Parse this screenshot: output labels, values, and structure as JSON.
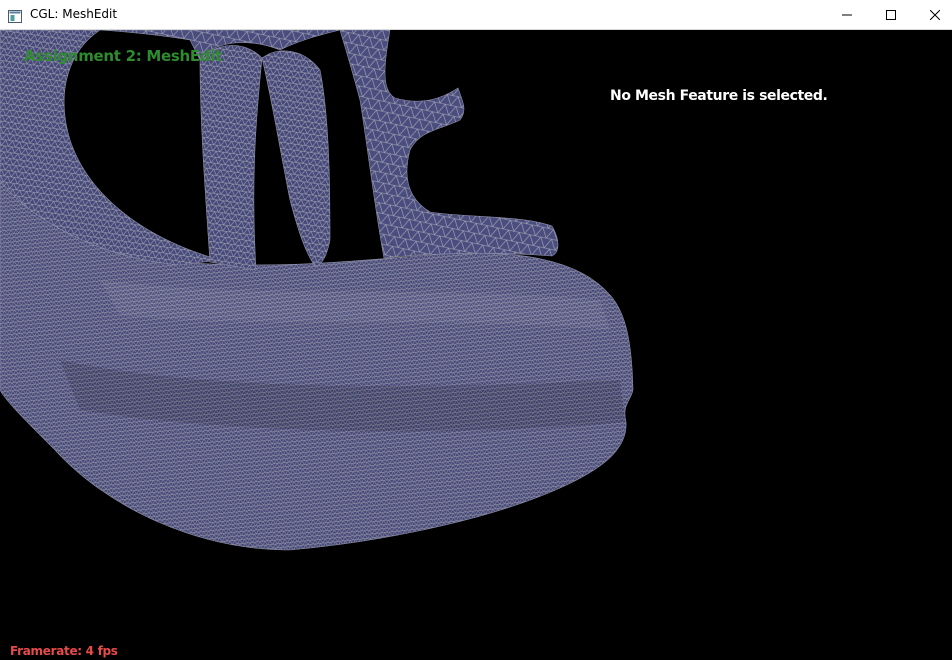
{
  "window": {
    "title": "CGL: MeshEdit",
    "icon": "app-window-icon",
    "controls": {
      "minimize_icon": "minimize-icon",
      "maximize_icon": "maximize-icon",
      "close_icon": "close-icon"
    }
  },
  "viewport": {
    "background_color": "#000000",
    "assignment_title": "Assignment 2: MeshEdit",
    "assignment_title_color": "#2e8b2e",
    "feature_status": "No Mesh Feature is selected.",
    "feature_status_color": "#ffffff",
    "framerate_text": "Framerate: 4 fps",
    "framerate_color": "#e84a4a",
    "mesh": {
      "fill_color": "#46497a",
      "wire_color": "#a9aab6",
      "rendering": "wireframe-over-shaded"
    }
  }
}
